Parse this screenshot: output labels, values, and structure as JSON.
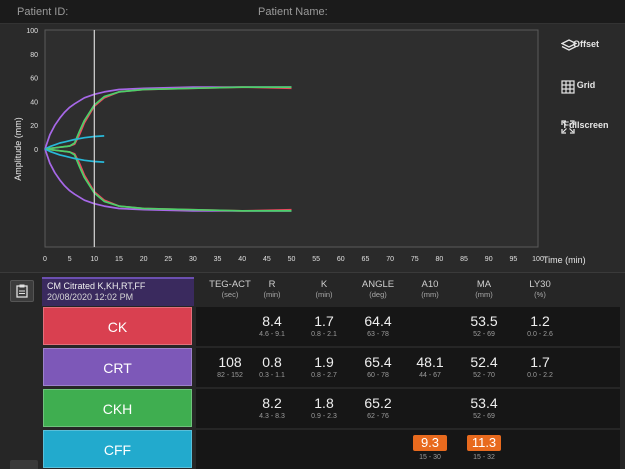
{
  "header": {
    "patient_id_label": "Patient ID:",
    "patient_name_label": "Patient Name:"
  },
  "chart_data": {
    "type": "line",
    "ylabel": "Amplitude (mm)",
    "xlabel": "Time (min)",
    "xlim": [
      0,
      100
    ],
    "ylim": [
      -100,
      100
    ],
    "x_ticks": [
      "0",
      "5",
      "10",
      "15",
      "20",
      "25",
      "30",
      "35",
      "40",
      "45",
      "50",
      "55",
      "60",
      "65",
      "70",
      "75",
      "80",
      "85",
      "90",
      "95",
      "100"
    ],
    "y_ticks": [
      "100",
      "80",
      "60",
      "40",
      "20",
      "0"
    ],
    "cursor_x": 10,
    "series": [
      {
        "color": "#a768e8",
        "x": [
          0,
          1,
          2,
          3,
          4,
          5,
          6,
          8,
          10,
          12,
          15,
          20,
          30,
          40,
          50
        ],
        "y": [
          0,
          12,
          20,
          26,
          31,
          35,
          38,
          43,
          46,
          48,
          50,
          51,
          52,
          52,
          52
        ]
      },
      {
        "color": "#e84a5f",
        "x": [
          0,
          2,
          3,
          4,
          5,
          6,
          7,
          8,
          10,
          12,
          15,
          20,
          30,
          40,
          50
        ],
        "y": [
          0,
          1,
          1.5,
          2,
          2.5,
          4,
          12,
          22,
          36,
          43,
          48,
          50,
          51,
          52,
          51
        ]
      },
      {
        "color": "#4bd06a",
        "x": [
          0,
          2,
          4,
          5,
          6,
          7,
          8,
          10,
          12,
          15,
          20,
          30,
          40,
          50
        ],
        "y": [
          0,
          1,
          2,
          2.5,
          5,
          15,
          24,
          37,
          44,
          48,
          50,
          51,
          52,
          52
        ]
      },
      {
        "color": "#28b8d8",
        "x": [
          0,
          1,
          2,
          3,
          4,
          5,
          6,
          8,
          10,
          12
        ],
        "y": [
          0,
          2,
          3.5,
          5,
          6,
          7,
          8,
          9.5,
          10.5,
          11
        ]
      },
      {
        "color": "#a768e8",
        "x": [
          0,
          1,
          2,
          3,
          4,
          5,
          6,
          8,
          10,
          12,
          15,
          20,
          30,
          40,
          50
        ],
        "y": [
          0,
          -12,
          -20,
          -26,
          -31,
          -35,
          -38,
          -43,
          -46,
          -48,
          -50,
          -51,
          -52,
          -52,
          -52
        ]
      },
      {
        "color": "#e84a5f",
        "x": [
          0,
          2,
          3,
          4,
          5,
          6,
          7,
          8,
          10,
          12,
          15,
          20,
          30,
          40,
          50
        ],
        "y": [
          0,
          -1,
          -1.5,
          -2,
          -2.5,
          -4,
          -12,
          -22,
          -36,
          -43,
          -48,
          -50,
          -51,
          -52,
          -51
        ]
      },
      {
        "color": "#4bd06a",
        "x": [
          0,
          2,
          4,
          5,
          6,
          7,
          8,
          10,
          12,
          15,
          20,
          30,
          40,
          50
        ],
        "y": [
          0,
          -1,
          -2,
          -2.5,
          -5,
          -15,
          -24,
          -37,
          -44,
          -48,
          -50,
          -51,
          -52,
          -52
        ]
      },
      {
        "color": "#28b8d8",
        "x": [
          0,
          1,
          2,
          3,
          4,
          5,
          6,
          8,
          10,
          12
        ],
        "y": [
          0,
          -2,
          -3.5,
          -5,
          -6,
          -7,
          -8,
          -9.5,
          -10.5,
          -11
        ]
      }
    ]
  },
  "side_buttons": {
    "offset": "Offset",
    "grid": "Grid",
    "fullscreen": "Fullscreen"
  },
  "sample": {
    "title": "CM Citrated K,KH,RT,FF",
    "datetime": "20/08/2020 12:02 PM"
  },
  "columns": [
    {
      "name": "TEG-ACT",
      "unit": "(sec)"
    },
    {
      "name": "R",
      "unit": "(min)"
    },
    {
      "name": "K",
      "unit": "(min)"
    },
    {
      "name": "ANGLE",
      "unit": "(deg)"
    },
    {
      "name": "A10",
      "unit": "(mm)"
    },
    {
      "name": "MA",
      "unit": "(mm)"
    },
    {
      "name": "LY30",
      "unit": "(%)"
    }
  ],
  "rows": [
    {
      "label": "CK",
      "color": "#d94050",
      "cells": [
        {
          "v": "",
          "r": ""
        },
        {
          "v": "8.4",
          "r": "4.6 - 9.1"
        },
        {
          "v": "1.7",
          "r": "0.8 - 2.1"
        },
        {
          "v": "64.4",
          "r": "63 - 78"
        },
        {
          "v": "",
          "r": ""
        },
        {
          "v": "53.5",
          "r": "52 - 69"
        },
        {
          "v": "1.2",
          "r": "0.0 - 2.6"
        }
      ]
    },
    {
      "label": "CRT",
      "color": "#7d58b8",
      "cells": [
        {
          "v": "108",
          "r": "82 - 152"
        },
        {
          "v": "0.8",
          "r": "0.3 - 1.1"
        },
        {
          "v": "1.9",
          "r": "0.8 - 2.7"
        },
        {
          "v": "65.4",
          "r": "60 - 78"
        },
        {
          "v": "48.1",
          "r": "44 - 67"
        },
        {
          "v": "52.4",
          "r": "52 - 70"
        },
        {
          "v": "1.7",
          "r": "0.0 - 2.2"
        }
      ]
    },
    {
      "label": "CKH",
      "color": "#3fae50",
      "cells": [
        {
          "v": "",
          "r": ""
        },
        {
          "v": "8.2",
          "r": "4.3 - 8.3"
        },
        {
          "v": "1.8",
          "r": "0.9 - 2.3"
        },
        {
          "v": "65.2",
          "r": "62 - 76"
        },
        {
          "v": "",
          "r": ""
        },
        {
          "v": "53.4",
          "r": "52 - 69"
        },
        {
          "v": "",
          "r": ""
        }
      ]
    },
    {
      "label": "CFF",
      "color": "#22aacd",
      "cells": [
        {
          "v": "",
          "r": ""
        },
        {
          "v": "",
          "r": ""
        },
        {
          "v": "",
          "r": ""
        },
        {
          "v": "",
          "r": ""
        },
        {
          "v": "9.3",
          "r": "15 - 30",
          "flag": true
        },
        {
          "v": "11.3",
          "r": "15 - 32",
          "flag": true
        },
        {
          "v": "",
          "r": ""
        }
      ]
    }
  ]
}
